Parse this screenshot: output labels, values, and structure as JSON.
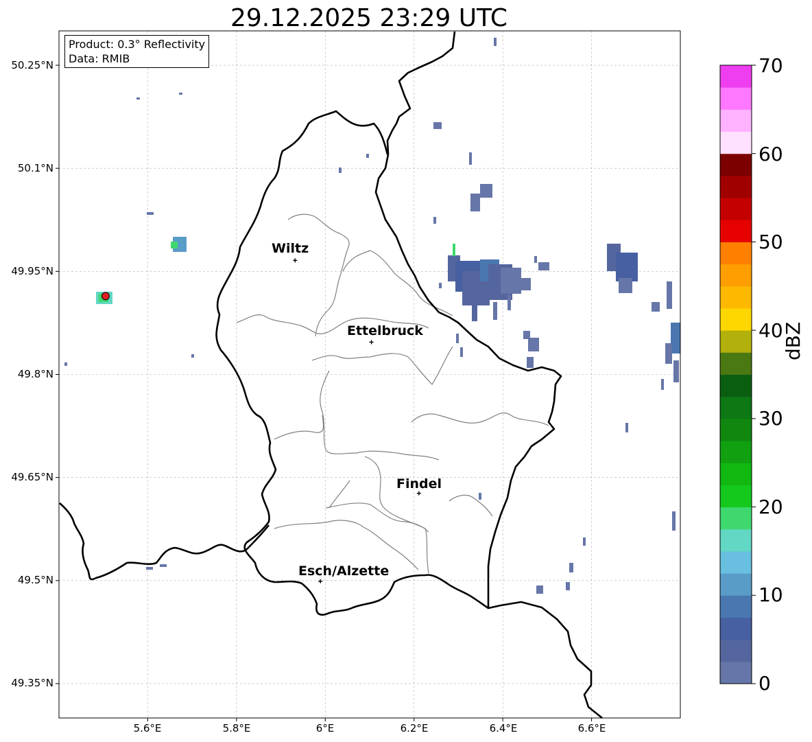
{
  "title": "29.12.2025 23:29 UTC",
  "info": {
    "product": "Product: 0.3° Reflectivity",
    "data": "Data: RMIB"
  },
  "axes": {
    "lat_ticks": [
      "50.25°N",
      "50.1°N",
      "49.95°N",
      "49.8°N",
      "49.65°N",
      "49.5°N",
      "49.35°N"
    ],
    "lon_ticks": [
      "5.6°E",
      "5.8°E",
      "6°E",
      "6.2°E",
      "6.4°E",
      "6.6°E"
    ],
    "lat_range": [
      49.3,
      50.3
    ],
    "lon_range": [
      5.4,
      6.8
    ],
    "grid": true
  },
  "cities": [
    {
      "name": "Wiltz",
      "lat": 49.966,
      "lon": 5.932
    },
    {
      "name": "Ettelbruck",
      "lat": 49.847,
      "lon": 6.104
    },
    {
      "name": "Findel",
      "lat": 49.627,
      "lon": 6.211
    },
    {
      "name": "Esch/Alzette",
      "lat": 49.499,
      "lon": 5.989
    }
  ],
  "radar_site": {
    "lat": 49.914,
    "lon": 5.505,
    "color": "#e02020"
  },
  "colorbar": {
    "label": "dBZ",
    "min": 0,
    "max": 70,
    "ticks": [
      "70",
      "60",
      "50",
      "40",
      "30",
      "20",
      "10",
      "0"
    ],
    "colors": [
      "#6676a8",
      "#55669e",
      "#4660a2",
      "#4a77b0",
      "#5a9cc8",
      "#68bfe0",
      "#62d8c4",
      "#3ed86e",
      "#14c81c",
      "#10b810",
      "#10a010",
      "#108810",
      "#0d7814",
      "#0a5e10",
      "#4a7812",
      "#b2b00a",
      "#ffd700",
      "#ffb800",
      "#ff9e00",
      "#ff8000",
      "#e60000",
      "#c40000",
      "#a00000",
      "#7c0000",
      "#ffe0ff",
      "#ffb2ff",
      "#ff78ff",
      "#ee3ef0"
    ]
  },
  "colors": {
    "border": "#000000",
    "cantons": "#808080",
    "grid": "#b0b0b0"
  }
}
